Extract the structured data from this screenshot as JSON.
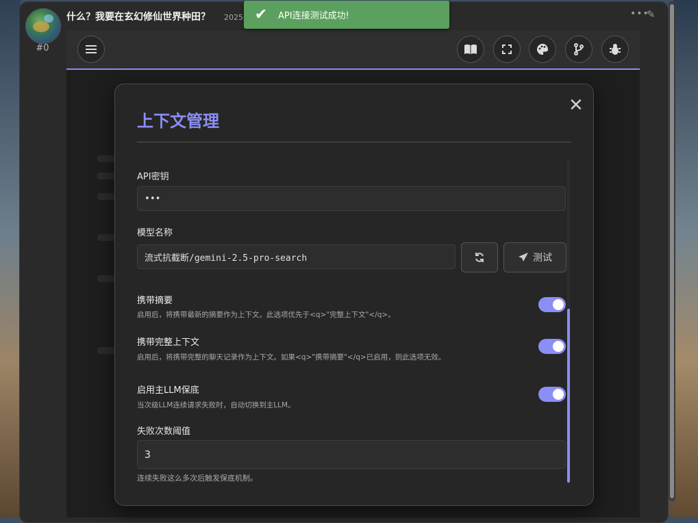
{
  "message": {
    "index": "#0",
    "title": "什么？我要在玄幻修仙世界种田？",
    "date": "2025年"
  },
  "toast": {
    "text": "API连接测试成功!",
    "color": "#5ba05e"
  },
  "modal": {
    "title": "上下文管理",
    "api_key_label": "API密钥",
    "api_key_value": "•••",
    "model_label": "模型名称",
    "model_value": "流式抗截断/gemini-2.5-pro-search",
    "test_button": "测试",
    "toggles": [
      {
        "title": "携带摘要",
        "desc": "启用后，将携带最新的摘要作为上下文。此选项优先于<q>\"完整上下文\"</q>。",
        "on": true
      },
      {
        "title": "携带完整上下文",
        "desc": "启用后，将携带完整的聊天记录作为上下文。如果<q>\"携带摘要\"</q>已启用，则此选项无效。",
        "on": true
      },
      {
        "title": "启用主LLM保底",
        "desc": "当次级LLM连续请求失败时，自动切换到主LLM。",
        "on": true
      }
    ],
    "threshold_label": "失败次数阈值",
    "threshold_value": "3",
    "threshold_help": "连续失败这么多次后触发保底机制。"
  },
  "icons": {
    "menu": "menu-icon",
    "book": "book-icon",
    "fullscreen": "fullscreen-icon",
    "palette": "palette-icon",
    "branch": "branch-icon",
    "bug": "bug-icon",
    "refresh": "refresh-icon",
    "send": "send-icon",
    "close": "close-icon",
    "check": "check-icon"
  },
  "colors": {
    "accent": "#8b8ff5",
    "toast": "#5ba05e"
  }
}
